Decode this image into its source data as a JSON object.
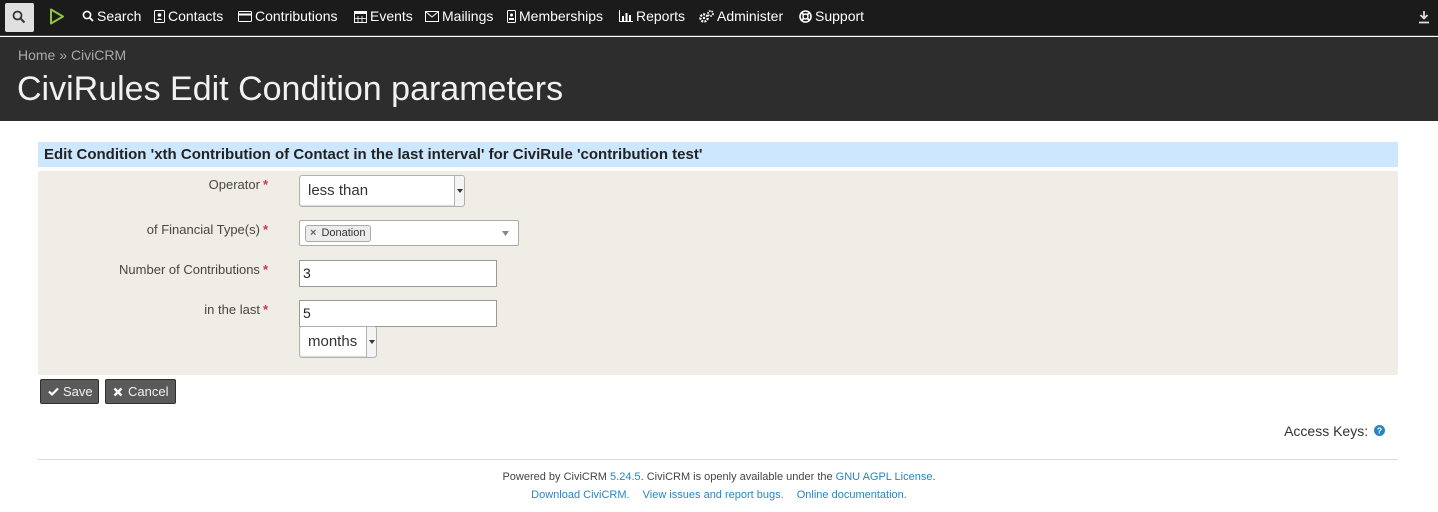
{
  "menu": {
    "items": [
      {
        "label": "Search",
        "icon": "search-icon"
      },
      {
        "label": "Contacts",
        "icon": "contact-card-icon"
      },
      {
        "label": "Contributions",
        "icon": "credit-card-icon"
      },
      {
        "label": "Events",
        "icon": "calendar-icon"
      },
      {
        "label": "Mailings",
        "icon": "envelope-icon"
      },
      {
        "label": "Memberships",
        "icon": "id-badge-icon"
      },
      {
        "label": "Reports",
        "icon": "bar-chart-icon"
      },
      {
        "label": "Administer",
        "icon": "gears-icon"
      },
      {
        "label": "Support",
        "icon": "life-ring-icon"
      }
    ]
  },
  "breadcrumb": {
    "home": "Home",
    "separator": " » ",
    "civicrm": "CiviCRM"
  },
  "page": {
    "title": "CiviRules Edit Condition parameters"
  },
  "form": {
    "header": "Edit Condition 'xth Contribution of Contact in the last interval' for CiviRule 'contribution test'",
    "required_mark": "*",
    "operator": {
      "label": "Operator",
      "value": "less than"
    },
    "financial_types": {
      "label": "of Financial Type(s)",
      "selected": [
        "Donation"
      ]
    },
    "num_contributions": {
      "label": "Number of Contributions",
      "value": "3"
    },
    "in_the_last": {
      "label": "in the last",
      "value": "5",
      "unit": "months"
    }
  },
  "buttons": {
    "save": "Save",
    "cancel": "Cancel"
  },
  "access_keys": {
    "label": "Access Keys:"
  },
  "footer": {
    "powered_by": "Powered by CiviCRM",
    "version": "5.24.5",
    "available_text": ". CiviCRM is openly available under the",
    "license": "GNU AGPL License",
    "period": ".",
    "download": "Download CiviCRM.",
    "issues": "View issues and report bugs.",
    "docs": "Online documentation."
  },
  "colors": {
    "menubar": "#1b1b1b",
    "header": "#2d2d2d",
    "form_header": "#cde8fe",
    "form_panel": "#efede5",
    "link": "#2786c2",
    "required": "#cf3458",
    "logo_green": "#8cc63f"
  }
}
